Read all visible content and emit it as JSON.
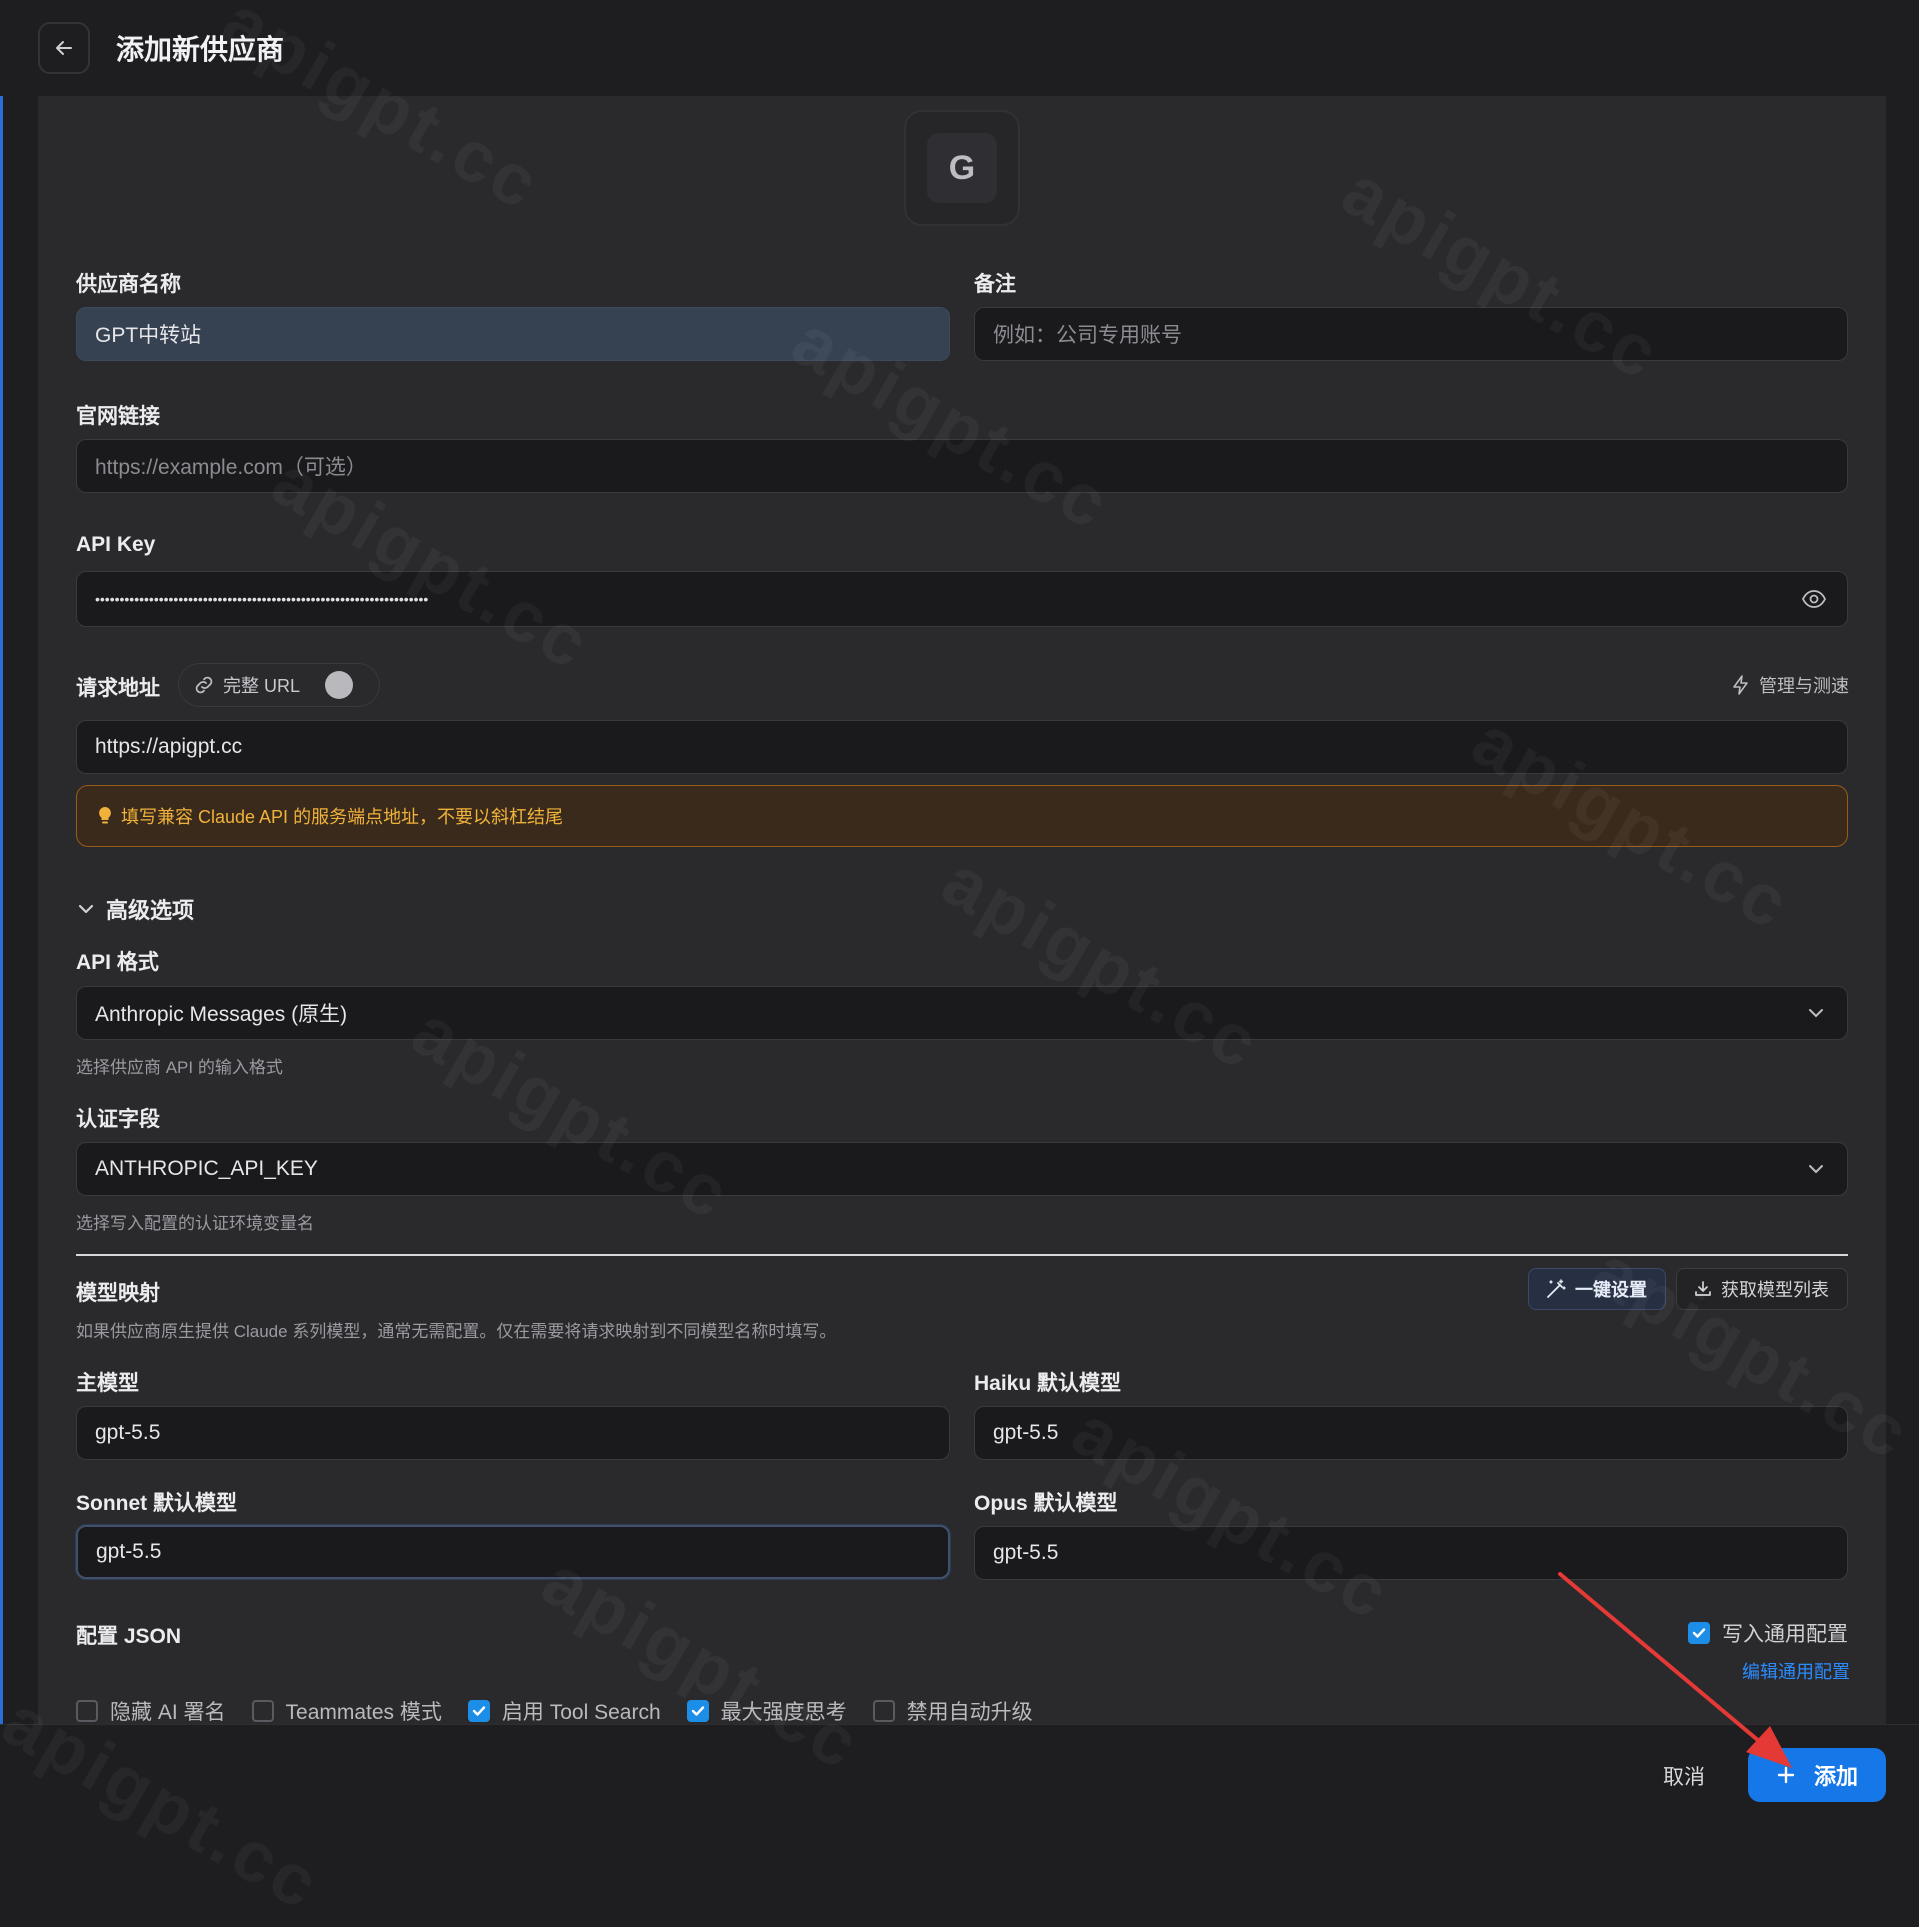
{
  "header": {
    "title": "添加新供应商"
  },
  "logo": {
    "letter": "G"
  },
  "provider_name": {
    "label": "供应商名称",
    "value": "GPT中转站"
  },
  "note": {
    "label": "备注",
    "placeholder": "例如：公司专用账号"
  },
  "website": {
    "label": "官网链接",
    "placeholder": "https://example.com（可选）"
  },
  "api_key": {
    "label": "API Key",
    "masked_value": "••••••••••••••••••••••••••••••••••••••••••••••••••••••••••••••••••••"
  },
  "request_url": {
    "label": "请求地址",
    "full_url_toggle_label": "完整 URL",
    "full_url_enabled": false,
    "manage_label": "管理与测速",
    "value": "https://apigpt.cc",
    "warning": "填写兼容 Claude API 的服务端点地址，不要以斜杠结尾"
  },
  "advanced": {
    "title": "高级选项",
    "api_format": {
      "label": "API 格式",
      "value": "Anthropic Messages (原生)",
      "hint": "选择供应商 API 的输入格式"
    },
    "auth_field": {
      "label": "认证字段",
      "value": "ANTHROPIC_API_KEY",
      "hint": "选择写入配置的认证环境变量名"
    }
  },
  "model_mapping": {
    "title": "模型映射",
    "description": "如果供应商原生提供 Claude 系列模型，通常无需配置。仅在需要将请求映射到不同模型名称时填写。",
    "one_click_label": "一键设置",
    "fetch_list_label": "获取模型列表",
    "main": {
      "label": "主模型",
      "value": "gpt-5.5"
    },
    "haiku": {
      "label": "Haiku 默认模型",
      "value": "gpt-5.5"
    },
    "sonnet": {
      "label": "Sonnet 默认模型",
      "value": "gpt-5.5"
    },
    "opus": {
      "label": "Opus 默认模型",
      "value": "gpt-5.5"
    }
  },
  "config_json": {
    "title": "配置 JSON",
    "write_common_label": "写入通用配置",
    "write_common_checked": true,
    "edit_common_label": "编辑通用配置"
  },
  "options": [
    {
      "label": "隐藏 AI 署名",
      "checked": false
    },
    {
      "label": "Teammates 模式",
      "checked": false
    },
    {
      "label": "启用 Tool Search",
      "checked": true
    },
    {
      "label": "最大强度思考",
      "checked": true
    },
    {
      "label": "禁用自动升级",
      "checked": false
    }
  ],
  "footer": {
    "cancel_label": "取消",
    "add_label": "添加"
  },
  "watermark": "apigpt.cc",
  "colors": {
    "accent": "#1677e8",
    "warning": "#f0b23a",
    "annotation_arrow": "#e53935"
  }
}
